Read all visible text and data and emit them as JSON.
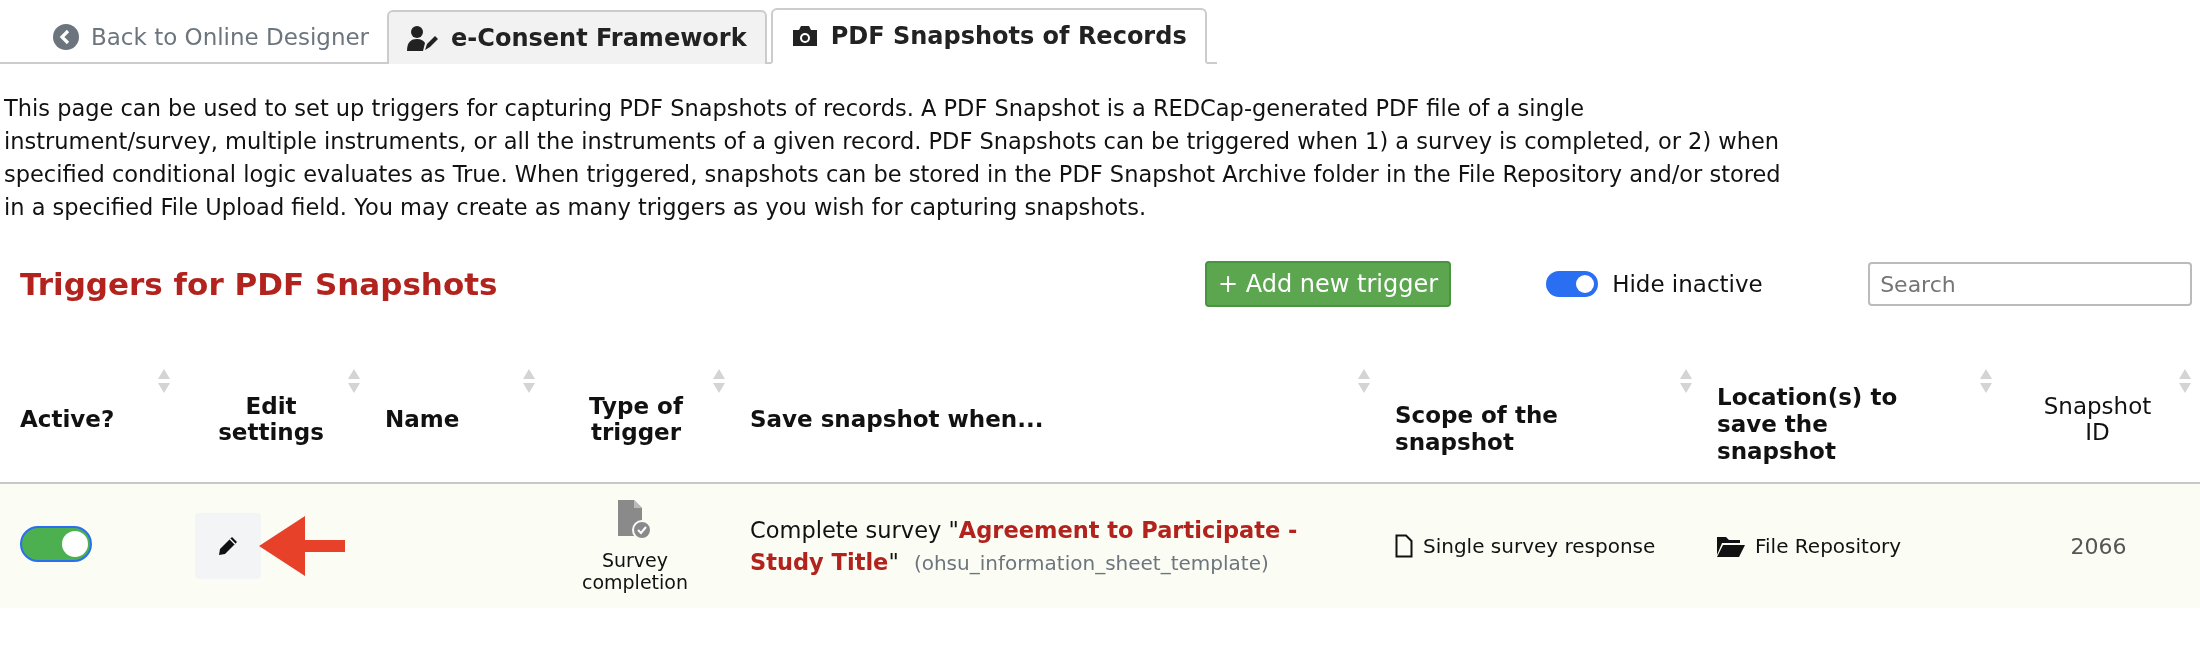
{
  "back_link": "Back to Online Designer",
  "tabs": [
    {
      "label": "e-Consent Framework",
      "kind": "consent",
      "selected": false
    },
    {
      "label": "PDF Snapshots of Records",
      "kind": "camera",
      "selected": true
    }
  ],
  "intro": "This page can be used to set up triggers for capturing PDF Snapshots of records. A PDF Snapshot is a REDCap-generated PDF file of a single instrument/survey, multiple instruments, or all the instruments of a given record. PDF Snapshots can be triggered when 1) a survey is completed, or 2) when specified conditional logic evaluates as True. When triggered, snapshots can be stored in the PDF Snapshot Archive folder in the File Repository and/or stored in a specified File Upload field. You may create as many triggers as you wish for capturing snapshots.",
  "section_title": "Triggers for PDF Snapshots",
  "add_button": "+ Add new trigger",
  "hide_inactive": {
    "label": "Hide inactive",
    "on": true
  },
  "search": {
    "placeholder": "Search"
  },
  "table": {
    "columns": [
      {
        "label": "Active?",
        "bold": true
      },
      {
        "label": "Edit settings",
        "bold": true
      },
      {
        "label": "Name",
        "bold": true
      },
      {
        "label": "Type of trigger",
        "bold": true
      },
      {
        "label": "Save snapshot when...",
        "bold": true
      },
      {
        "label": "Scope of the snapshot",
        "bold": true
      },
      {
        "label": "Location(s) to save the snapshot",
        "bold": true
      },
      {
        "label": "Snapshot ID",
        "bold": false
      }
    ],
    "rows": [
      {
        "active": true,
        "trigger_type": "Survey completion",
        "condition_prefix": "Complete survey \"",
        "survey_title": "Agreement to Participate - Study Title",
        "condition_suffix": "\"",
        "survey_name": "(ohsu_information_sheet_template)",
        "scope": "Single survey response",
        "location": "File Repository",
        "snapshot_id": "2066"
      }
    ]
  }
}
